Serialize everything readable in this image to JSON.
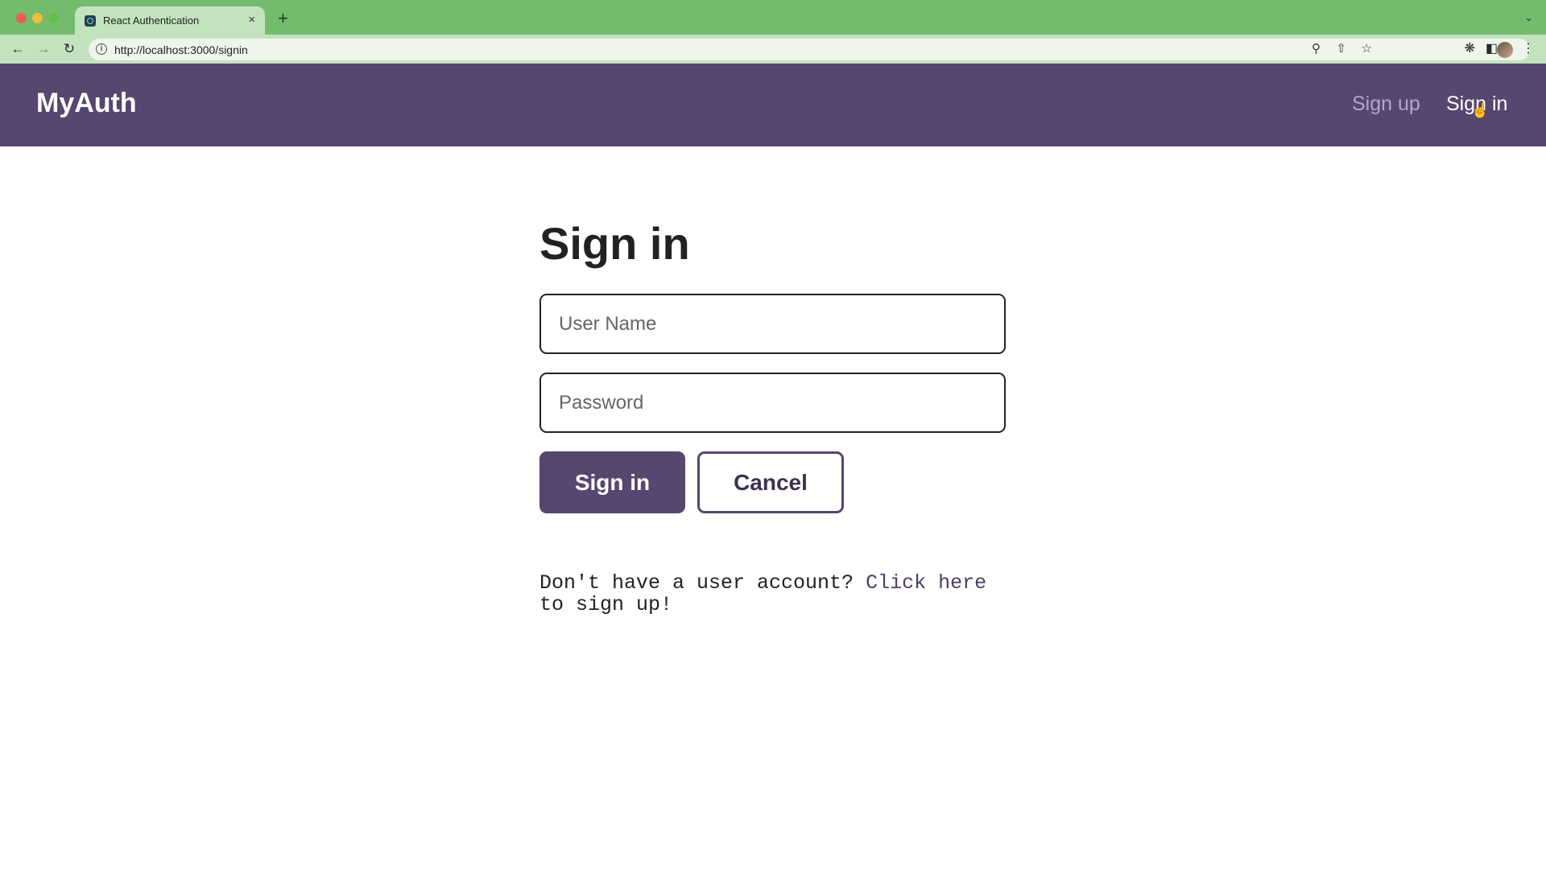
{
  "browser": {
    "tab_title": "React Authentication",
    "tab_close": "×",
    "new_tab": "+",
    "url": "http://localhost:3000/signin"
  },
  "navbar": {
    "brand": "MyAuth",
    "links": [
      {
        "label": "Sign up"
      },
      {
        "label": "Sign in"
      }
    ]
  },
  "form": {
    "title": "Sign in",
    "username_placeholder": "User Name",
    "password_placeholder": "Password",
    "submit_label": "Sign in",
    "cancel_label": "Cancel"
  },
  "signup_prompt": {
    "before": "Don't have a user account? ",
    "link": "Click here",
    "after": " to sign up!"
  },
  "colors": {
    "navbar_bg": "#57466f",
    "chrome_tabstrip": "#74bb6e",
    "chrome_toolbar": "#c3e3be"
  }
}
